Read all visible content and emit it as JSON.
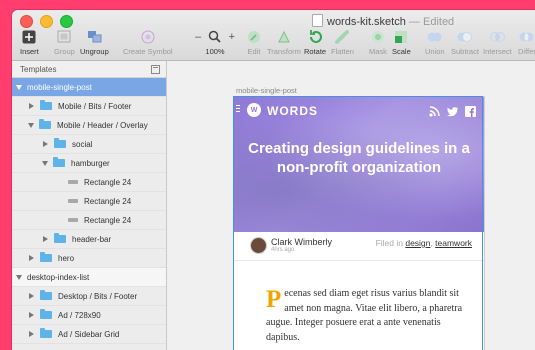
{
  "window": {
    "document_title": "words-kit.sketch",
    "edited_label": "Edited",
    "separator": "—"
  },
  "toolbar": {
    "insert": "Insert",
    "group": "Group",
    "ungroup": "Ungroup",
    "create_symbol": "Create Symbol",
    "zoom": "100%",
    "zoom_minus": "–",
    "zoom_plus": "+",
    "edit": "Edit",
    "transform": "Transform",
    "rotate": "Rotate",
    "flatten": "Flatten",
    "mask": "Mask",
    "scale": "Scale",
    "union": "Union",
    "subtract": "Subtract",
    "intersect": "Intersect",
    "difference": "Differ"
  },
  "sidebar": {
    "page": "Templates",
    "layers": [
      {
        "label": "mobile-single-post",
        "kind": "artboard",
        "expanded": true,
        "indent": 0,
        "selected": true
      },
      {
        "label": "Mobile / Bits / Footer",
        "kind": "folder",
        "expanded": false,
        "indent": 1
      },
      {
        "label": "Mobile / Header / Overlay",
        "kind": "folder",
        "expanded": true,
        "indent": 1
      },
      {
        "label": "social",
        "kind": "folder",
        "expanded": false,
        "indent": 2
      },
      {
        "label": "hamburger",
        "kind": "folder",
        "expanded": true,
        "indent": 2
      },
      {
        "label": "Rectangle 24",
        "kind": "rect",
        "indent": 3
      },
      {
        "label": "Rectangle 24",
        "kind": "rect",
        "indent": 3
      },
      {
        "label": "Rectangle 24",
        "kind": "rect",
        "indent": 3
      },
      {
        "label": "header-bar",
        "kind": "folder",
        "expanded": false,
        "indent": 2
      },
      {
        "label": "hero",
        "kind": "folder",
        "expanded": false,
        "indent": 1
      },
      {
        "label": "desktop-index-list",
        "kind": "artboard",
        "expanded": true,
        "indent": 0
      },
      {
        "label": "Desktop / Bits / Footer",
        "kind": "folder",
        "expanded": false,
        "indent": 1
      },
      {
        "label": "Ad / 728x90",
        "kind": "folder",
        "expanded": false,
        "indent": 1
      },
      {
        "label": "Ad / Sidebar Grid",
        "kind": "folder",
        "expanded": false,
        "indent": 1
      }
    ]
  },
  "canvas": {
    "artboard_label": "mobile-single-post",
    "brand": "WORDS",
    "logo_text": "W",
    "hero_title": "Creating design guidelines in a non-profit organization",
    "author_name": "Clark Wimberly",
    "time_ago": "4hrs ago",
    "filed_in_label": "Filed in",
    "tags": [
      "design",
      "teamwork"
    ],
    "tag_separator": ",",
    "dropcap": "P",
    "paragraph": "ecenas sed diam eget risus varius blandit sit amet non magna. Vitae elit libero, a pharetra augue. Integer posuere erat a ante venenatis dapibus."
  },
  "colors": {
    "background": "#ff3d6e",
    "selection": "#7aa6e6",
    "hero": "#8e79d6",
    "dropcap": "#f0a500",
    "folder": "#5eb3e8"
  }
}
